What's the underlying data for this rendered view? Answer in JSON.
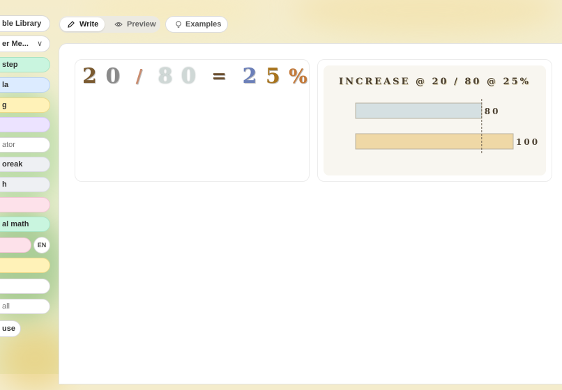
{
  "sidebar": {
    "items": [
      {
        "label": "ble Library"
      },
      {
        "label": "er Me...",
        "icon": "chevron-down-icon"
      },
      {
        "label": "step",
        "color": "#c9f5df"
      },
      {
        "label": "la",
        "color": "#dcebff"
      },
      {
        "label": "g",
        "color": "#fff2b8"
      },
      {
        "label": "",
        "color": "#ece3ff"
      },
      {
        "label": "ator"
      },
      {
        "label": "oreak",
        "color": "#eef0f3"
      },
      {
        "label": "h",
        "color": "#eef0f3"
      },
      {
        "label": "",
        "color": "#fde1ea"
      },
      {
        "label": "al math",
        "color": "#c9f5df"
      },
      {
        "label": "",
        "color": "#fde1ea"
      },
      {
        "label": "",
        "color": "#fff2b8"
      },
      {
        "label": ""
      },
      {
        "label": "all"
      },
      {
        "label": "use"
      }
    ],
    "language_badge": "EN"
  },
  "toolbar": {
    "write_label": "Write",
    "preview_label": "Preview",
    "examples_label": "Examples"
  },
  "equation": {
    "glyphs": [
      "2",
      "0",
      "/",
      "8",
      "0",
      "=",
      "2",
      "5",
      "%"
    ]
  },
  "chart_data": {
    "type": "bar",
    "title": "INCREASE @ 20 / 80 @ 25%",
    "categories": [
      "80",
      "100"
    ],
    "values": [
      80,
      100
    ],
    "reference_line": 80,
    "colors": [
      "#d5e0e2",
      "#efd8a6"
    ],
    "xlim": [
      0,
      100
    ]
  }
}
